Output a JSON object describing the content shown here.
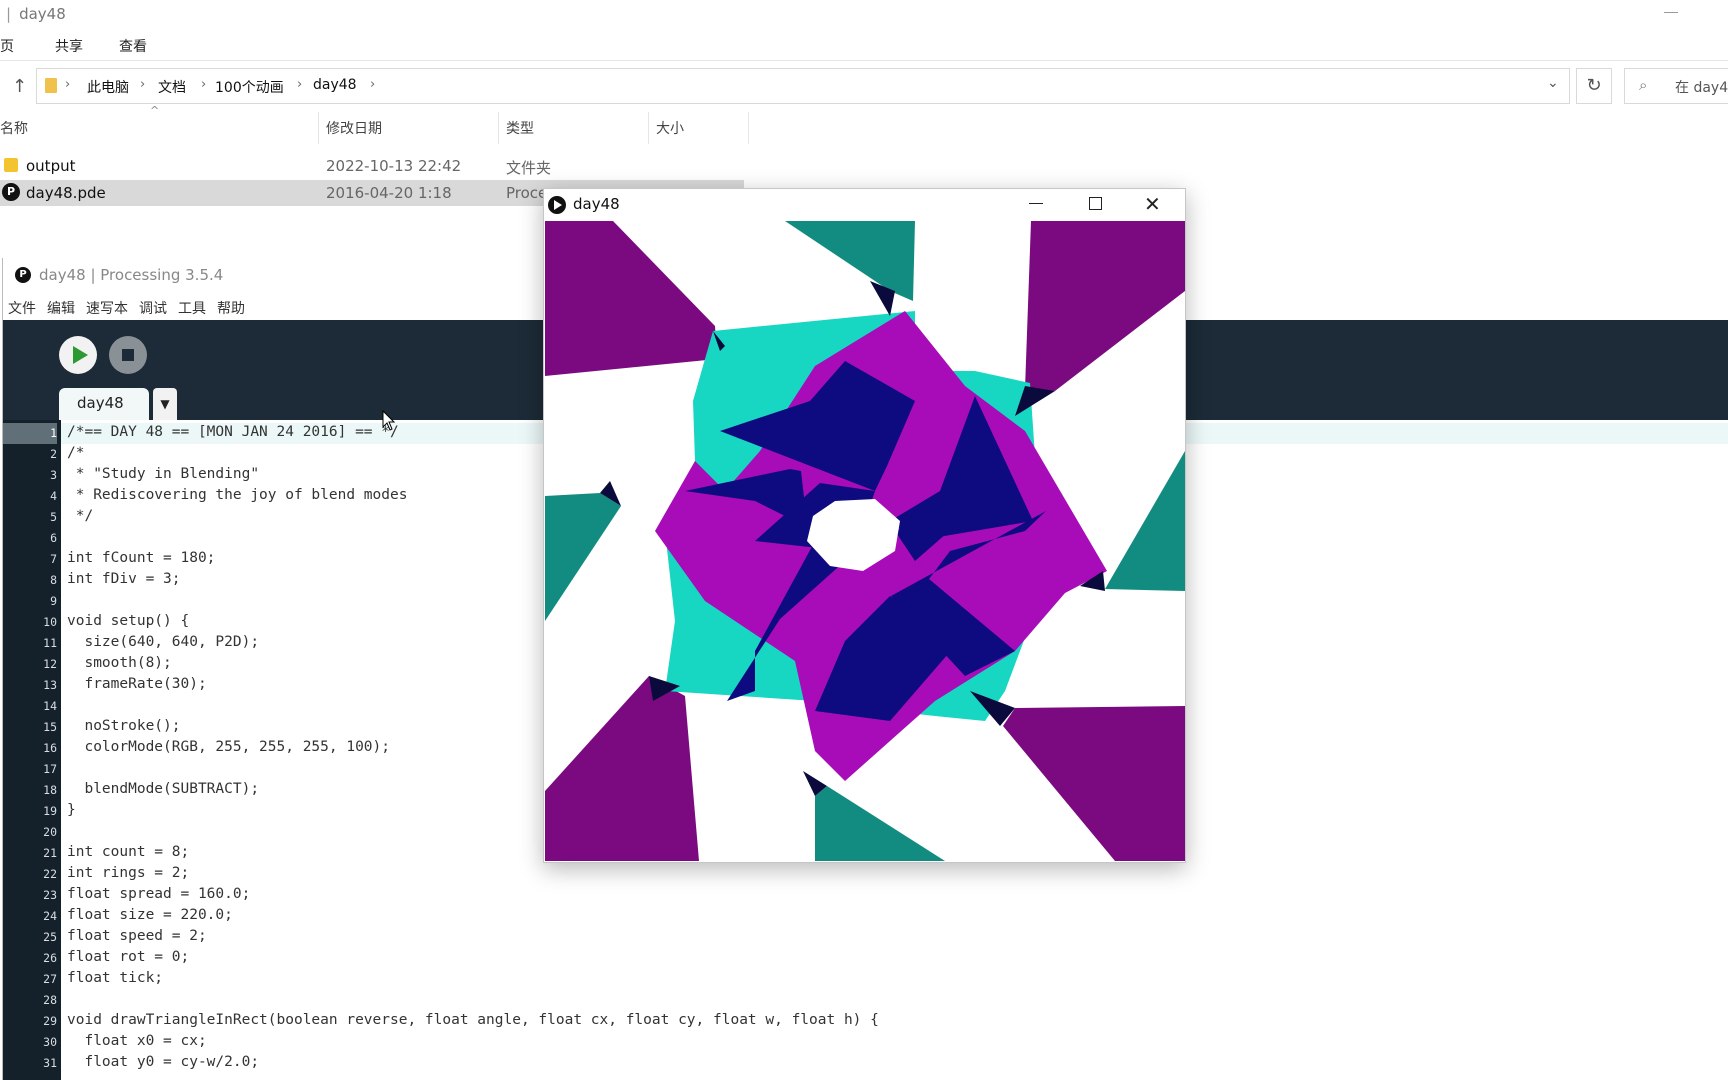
{
  "explorer": {
    "title": "day48",
    "ribbon": [
      "主页",
      "共享",
      "查看"
    ],
    "breadcrumb": [
      "此电脑",
      "文档",
      "100个动画",
      "day48"
    ],
    "search_placeholder": "在 day4",
    "columns": [
      "名称",
      "修改日期",
      "类型",
      "大小"
    ],
    "files": [
      {
        "name": "output",
        "date": "2022-10-13 22:42",
        "type": "文件夹",
        "icon": "folder-icon"
      },
      {
        "name": "day48.pde",
        "date": "2016-04-20 1:18",
        "type": "Proce",
        "icon": "processing-file-icon"
      }
    ]
  },
  "ide": {
    "title": "day48 | Processing 3.5.4",
    "menu": [
      "文件",
      "编辑",
      "速写本",
      "调试",
      "工具",
      "帮助"
    ],
    "tab": "day48",
    "active_line": 1,
    "code": [
      "/*== DAY 48 == [MON JAN 24 2016] == */",
      "/*",
      " * \"Study in Blending\"",
      " * Rediscovering the joy of blend modes",
      " */",
      "",
      "int fCount = 180;",
      "int fDiv = 3;",
      "",
      "void setup() {",
      "  size(640, 640, P2D);",
      "  smooth(8);",
      "  frameRate(30);",
      "",
      "  noStroke();",
      "  colorMode(RGB, 255, 255, 255, 100);",
      "",
      "  blendMode(SUBTRACT);",
      "}",
      "",
      "int count = 8;",
      "int rings = 2;",
      "float spread = 160.0;",
      "float size = 220.0;",
      "float speed = 2;",
      "float rot = 0;",
      "float tick;",
      "",
      "void drawTriangleInRect(boolean reverse, float angle, float cx, float cy, float w, float h) {",
      "  float x0 = cx;",
      "  float y0 = cy-w/2.0;"
    ]
  },
  "sketch": {
    "title": "day48",
    "colors": {
      "purple": "#7b0a80",
      "teal": "#128c80",
      "cyan": "#17d6c2",
      "magenta": "#a80cb8",
      "navy": "#0e0b80",
      "dark": "#0a0a3c"
    }
  }
}
